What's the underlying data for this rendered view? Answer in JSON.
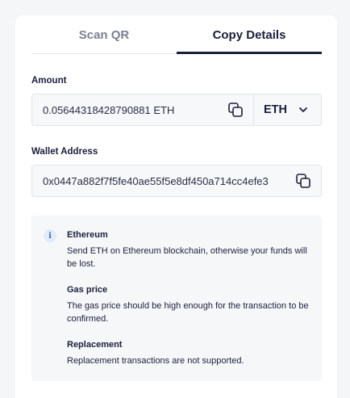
{
  "tabs": [
    {
      "label": "Scan QR",
      "active": false
    },
    {
      "label": "Copy Details",
      "active": true
    }
  ],
  "amount": {
    "label": "Amount",
    "value": "0.05644318428790881 ETH",
    "currency": "ETH",
    "copy_icon": "copy-icon",
    "dropdown_icon": "chevron-down-icon"
  },
  "wallet": {
    "label": "Wallet Address",
    "value": "0x0447a882f7f5fe40ae55f5e8df450a714cc4efe3",
    "copy_icon": "copy-icon"
  },
  "info": {
    "icon": "info-icon",
    "sections": [
      {
        "title": "Ethereum",
        "text": "Send ETH on Ethereum blockchain, otherwise your funds will be lost."
      },
      {
        "title": "Gas price",
        "text": "The gas price should be high enough for the transaction to be confirmed."
      },
      {
        "title": "Replacement",
        "text": "Replacement transactions are not supported."
      }
    ]
  },
  "colors": {
    "primary_text": "#1b1f3b",
    "muted_text": "#7c8090",
    "field_bg": "#f7f8fa",
    "info_bg": "#f6f7f9",
    "info_accent": "#3b6fd0"
  }
}
